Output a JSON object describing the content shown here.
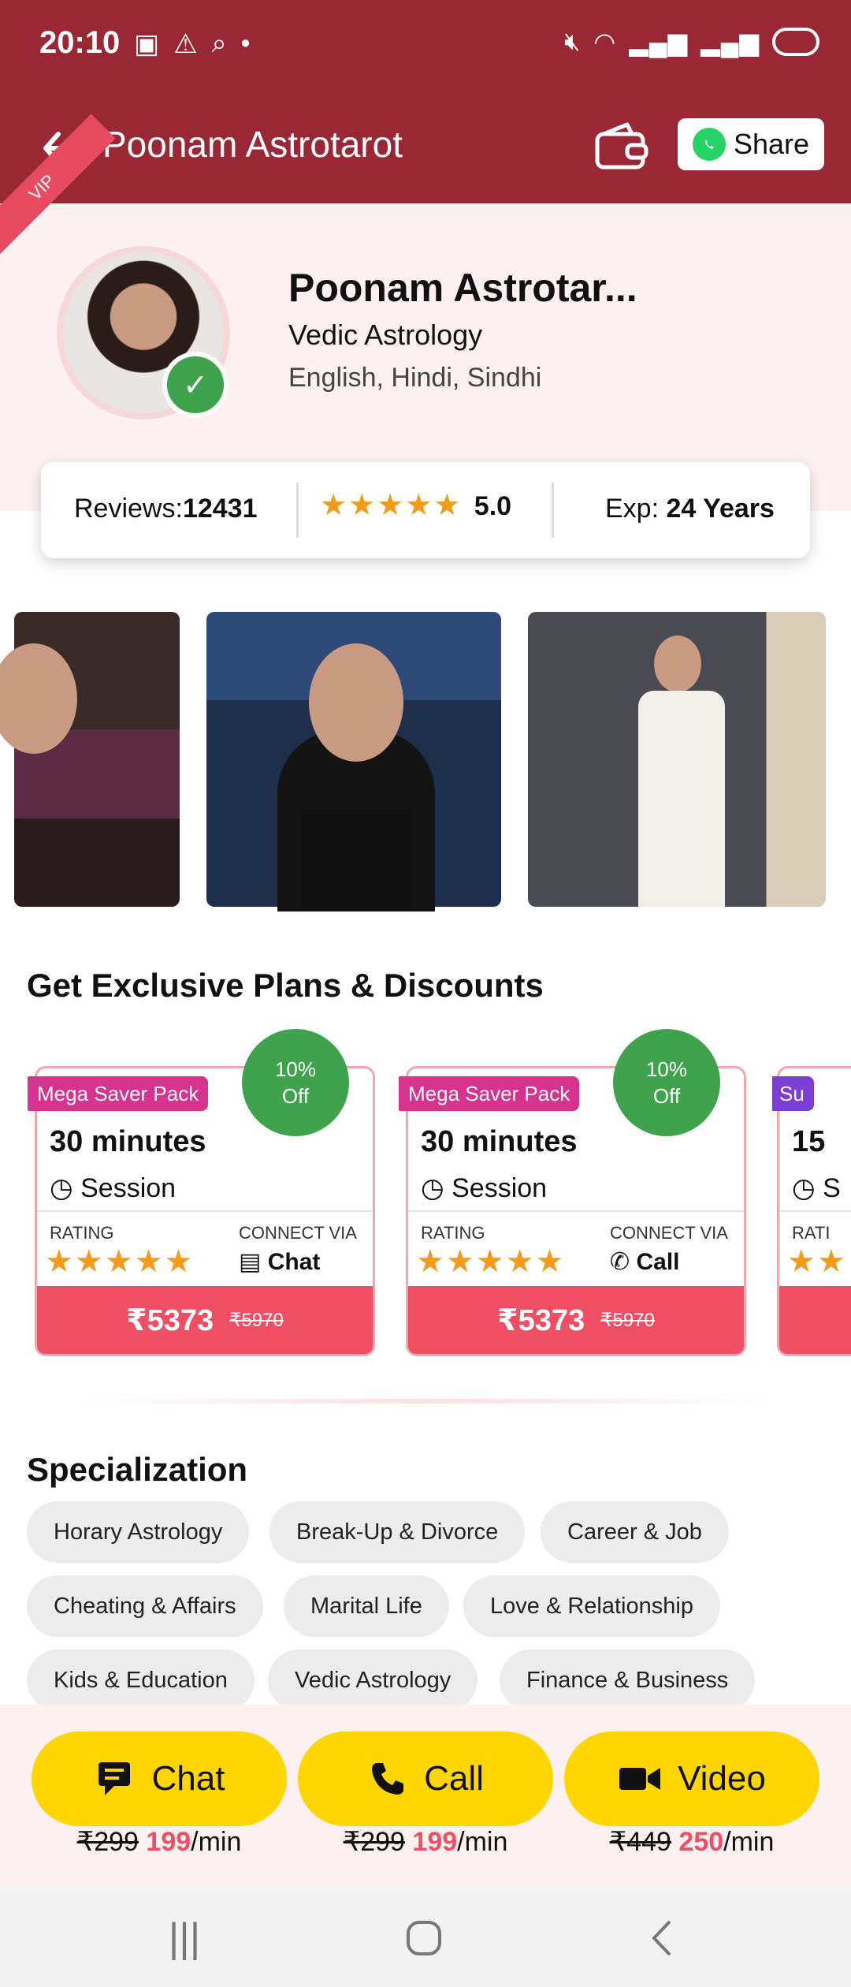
{
  "status_bar": {
    "time": "20:10"
  },
  "app_bar": {
    "title": "Poonam Astrotarot",
    "share_label": "Share"
  },
  "profile": {
    "vip_label": "VIP",
    "name": "Poonam Astrotar...",
    "skill": "Vedic Astrology",
    "languages": "English, Hindi, Sindhi",
    "reviews_label": "Reviews:",
    "reviews_count": "12431",
    "rating_value": "5.0",
    "exp_label": "Exp:",
    "exp_value": "24 Years"
  },
  "plans": {
    "title": "Get Exclusive Plans & Discounts",
    "cards": [
      {
        "badge": "Mega Saver Pack",
        "discount_line1": "10%",
        "discount_line2": "Off",
        "duration": "30 minutes",
        "session_label": "Session",
        "rating_label": "RATING",
        "connect_label": "CONNECT VIA",
        "connect_via": "Chat",
        "price_new": "₹5373",
        "price_old": "₹5970"
      },
      {
        "badge": "Mega Saver Pack",
        "discount_line1": "10%",
        "discount_line2": "Off",
        "duration": "30 minutes",
        "session_label": "Session",
        "rating_label": "RATING",
        "connect_label": "CONNECT VIA",
        "connect_via": "Call",
        "price_new": "₹5373",
        "price_old": "₹5970"
      },
      {
        "badge": "Su",
        "duration": "15",
        "session_label": "S",
        "rating_label": "RATI"
      }
    ]
  },
  "specialization": {
    "title": "Specialization",
    "chips": [
      "Horary Astrology",
      "Break-Up & Divorce",
      "Career & Job",
      "Cheating & Affairs",
      "Marital Life",
      "Love & Relationship",
      "Kids & Education",
      "Vedic Astrology",
      "Finance & Business"
    ]
  },
  "actions": [
    {
      "label": "Chat",
      "price_old": "₹299",
      "price_new": "199",
      "unit": "/min"
    },
    {
      "label": "Call",
      "price_old": "₹299",
      "price_new": "199",
      "unit": "/min"
    },
    {
      "label": "Video",
      "price_old": "₹449",
      "price_new": "250",
      "unit": "/min"
    }
  ],
  "colors": {
    "app_bar": "#9a2734",
    "header_bg": "#fdf0f1",
    "accent_pink": "#ef4e63",
    "badge_magenta": "#d6338e",
    "discount_green": "#3fa34d",
    "action_yellow": "#ffd600",
    "star": "#f49a1b"
  }
}
